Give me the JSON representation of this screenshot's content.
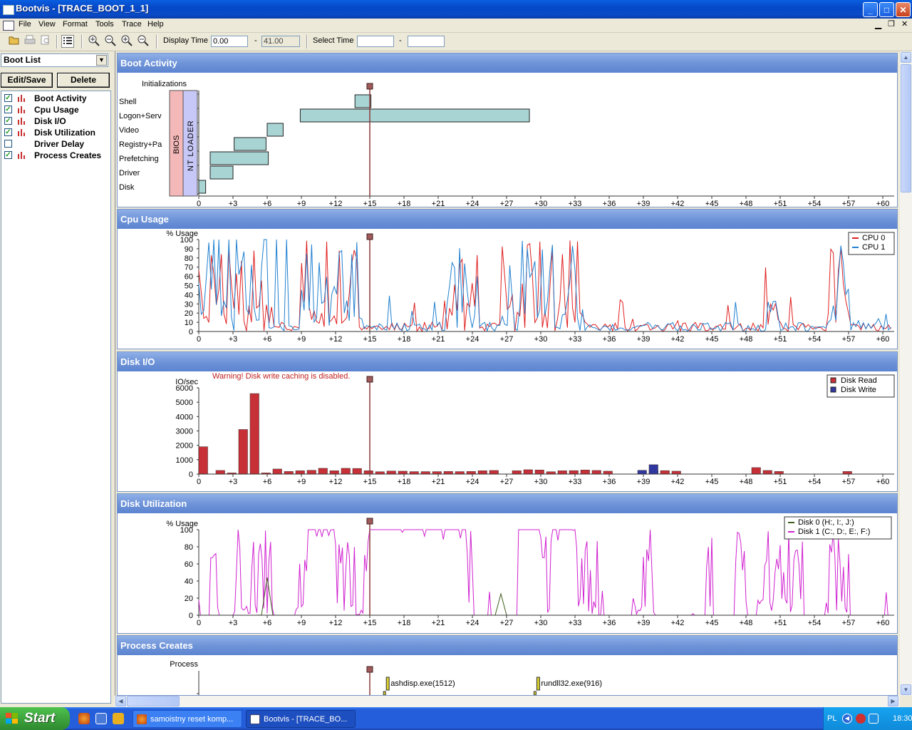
{
  "window": {
    "title": "Bootvis - [TRACE_BOOT_1_1]",
    "min": "_",
    "max": "□",
    "close": "✕"
  },
  "menu": [
    "File",
    "View",
    "Format",
    "Tools",
    "Trace",
    "Help"
  ],
  "toolbar": {
    "display_time_label": "Display Time",
    "display_time_start": "0.00",
    "display_time_dash": "-",
    "display_time_end": "41.00",
    "select_time_label": "Select Time",
    "select_time_start": "",
    "select_time_dash": "-",
    "select_time_end": ""
  },
  "left": {
    "boot_list": "Boot List",
    "edit_save": "Edit/Save",
    "delete": "Delete",
    "charts": [
      {
        "label": "Boot Activity",
        "checked": true
      },
      {
        "label": "Cpu Usage",
        "checked": true
      },
      {
        "label": "Disk I/O",
        "checked": true
      },
      {
        "label": "Disk Utilization",
        "checked": true
      },
      {
        "label": "Driver Delay",
        "checked": false
      },
      {
        "label": "Process Creates",
        "checked": true
      }
    ]
  },
  "x_ticks": [
    "0",
    "+3",
    "+6",
    "+9",
    "+12",
    "+15",
    "+18",
    "+21",
    "+24",
    "+27",
    "+30",
    "+33",
    "+36",
    "+39",
    "+42",
    "+45",
    "+48",
    "+51",
    "+54",
    "+57",
    "+60"
  ],
  "chart_data": [
    {
      "type": "bar",
      "title": "Boot Activity",
      "categories": [
        "Initializations",
        "Shell",
        "Logon+Serv",
        "Video",
        "Registry+Pa",
        "Prefetching",
        "Driver",
        "Disk"
      ],
      "phases": [
        {
          "name": "BIOS",
          "color": "#f5b8b8"
        },
        {
          "name": "NT LOADER",
          "color": "#c8c8f8"
        }
      ],
      "spans": [
        {
          "row": "Shell",
          "start": 13.7,
          "end": 15.1
        },
        {
          "row": "Logon+Serv",
          "start": 8.9,
          "end": 29.0
        },
        {
          "row": "Video",
          "start": 6.0,
          "end": 7.4
        },
        {
          "row": "Registry+Pa",
          "start": 3.1,
          "end": 5.9
        },
        {
          "row": "Prefetching",
          "start": 1.0,
          "end": 3.1
        },
        {
          "row": "Prefetching",
          "start": 1.0,
          "end": 6.1
        },
        {
          "row": "Driver",
          "start": 1.0,
          "end": 3.0
        },
        {
          "row": "Disk",
          "start": 0.0,
          "end": 0.6
        }
      ],
      "marker": 15,
      "xlim": [
        0,
        61
      ]
    },
    {
      "type": "line",
      "title": "Cpu Usage",
      "ylabel": "% Usage",
      "ylim": [
        0,
        100
      ],
      "yticks": [
        "100",
        "90",
        "80",
        "70",
        "60",
        "50",
        "40",
        "30",
        "20",
        "10",
        "0"
      ],
      "series": [
        {
          "name": "CPU 0",
          "color": "#e02020"
        },
        {
          "name": "CPU 1",
          "color": "#2080d0"
        }
      ],
      "marker": 15
    },
    {
      "type": "bar",
      "title": "Disk I/O",
      "ylabel": "IO/sec",
      "warning": "Warning!  Disk write caching is disabled.",
      "ylim": [
        0,
        6000
      ],
      "yticks": [
        "6000",
        "5000",
        "4000",
        "3000",
        "2000",
        "1000",
        "0"
      ],
      "series": [
        {
          "name": "Disk Read",
          "color": "#c83038",
          "values": [
            [
              0,
              1900
            ],
            [
              1.5,
              250
            ],
            [
              2.5,
              80
            ],
            [
              3.5,
              3100
            ],
            [
              4.5,
              5600
            ],
            [
              5.5,
              80
            ],
            [
              6.5,
              350
            ],
            [
              7.5,
              180
            ],
            [
              8.5,
              230
            ],
            [
              9.5,
              260
            ],
            [
              10.5,
              400
            ],
            [
              11.5,
              230
            ],
            [
              12.5,
              400
            ],
            [
              13.5,
              390
            ],
            [
              14.5,
              230
            ],
            [
              15.5,
              160
            ],
            [
              16.5,
              210
            ],
            [
              17.5,
              200
            ],
            [
              18.5,
              170
            ],
            [
              19.5,
              170
            ],
            [
              20.5,
              170
            ],
            [
              21.5,
              180
            ],
            [
              22.5,
              170
            ],
            [
              23.5,
              180
            ],
            [
              24.5,
              230
            ],
            [
              25.5,
              250
            ],
            [
              27.5,
              230
            ],
            [
              28.5,
              300
            ],
            [
              29.5,
              280
            ],
            [
              30.5,
              160
            ],
            [
              31.5,
              230
            ],
            [
              32.5,
              240
            ],
            [
              33.5,
              280
            ],
            [
              34.5,
              250
            ],
            [
              35.5,
              200
            ],
            [
              39.5,
              250
            ],
            [
              40.5,
              240
            ],
            [
              41.5,
              200
            ],
            [
              48.5,
              450
            ],
            [
              49.5,
              250
            ],
            [
              50.5,
              180
            ],
            [
              56.5,
              180
            ]
          ]
        },
        {
          "name": "Disk Write",
          "color": "#3038a0",
          "values": [
            [
              38.5,
              260
            ],
            [
              39.5,
              650
            ]
          ]
        }
      ],
      "marker": 15
    },
    {
      "type": "line",
      "title": "Disk Utilization",
      "ylabel": "% Usage",
      "ylim": [
        0,
        100
      ],
      "yticks": [
        "100",
        "80",
        "60",
        "40",
        "20",
        "0"
      ],
      "series": [
        {
          "name": "Disk 0 (H:, I:, J:)",
          "color": "#406020"
        },
        {
          "name": "Disk 1 (C:, D:, E:, F:)",
          "color": "#d020d0"
        }
      ],
      "marker": 15
    },
    {
      "type": "scatter",
      "title": "Process Creates",
      "ylabel": "Process",
      "points": [
        {
          "x": 16.7,
          "label": "ashdisp.exe(1512)"
        },
        {
          "x": 29.9,
          "label": "rundll32.exe(916)"
        }
      ],
      "marker": 15
    }
  ],
  "taskbar": {
    "start": "Start",
    "tasks": [
      "samoistny reset komp...",
      "Bootvis - [TRACE_BO..."
    ],
    "lang": "PL",
    "clock": "18:30"
  },
  "colors": {
    "accent": "#245edb",
    "panel_header": "#6f94d8",
    "bar_fill": "#a8d8d8"
  }
}
